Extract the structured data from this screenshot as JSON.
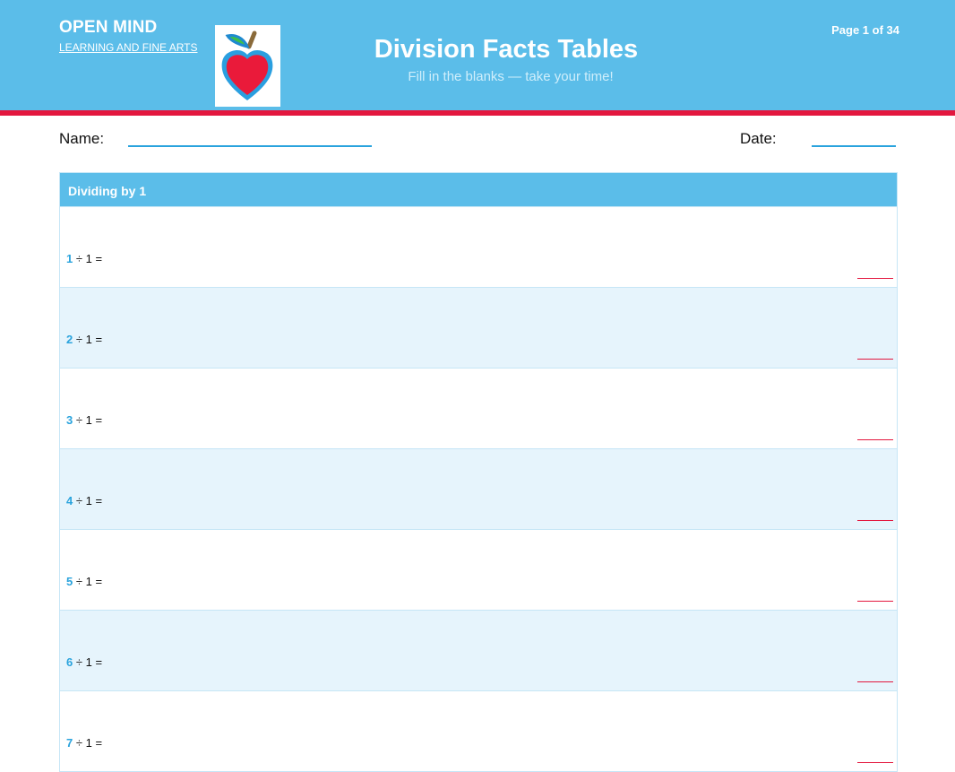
{
  "header": {
    "brand": "OPEN MIND",
    "brand_sub": "LEARNING AND FINE ARTS",
    "title": "Division Facts Tables",
    "subtitle": "Fill in the blanks — take your time!",
    "page": "Page 1 of 34",
    "logo_icon": "apple-icon"
  },
  "form": {
    "name_label": "Name:",
    "date_label": "Date:"
  },
  "table": {
    "heading": "Dividing by 1",
    "rows": [
      {
        "dividend": "1",
        "rest": "÷ 1 ="
      },
      {
        "dividend": "2",
        "rest": "÷ 1 ="
      },
      {
        "dividend": "3",
        "rest": "÷ 1 ="
      },
      {
        "dividend": "4",
        "rest": "÷ 1 ="
      },
      {
        "dividend": "5",
        "rest": "÷ 1 ="
      },
      {
        "dividend": "6",
        "rest": "÷ 1 ="
      },
      {
        "dividend": "7",
        "rest": "÷ 1 ="
      }
    ]
  },
  "colors": {
    "header_blue": "#5bbde9",
    "accent_red": "#e3173e",
    "row_alt": "#e6f4fc",
    "number_blue": "#2aa3dd"
  }
}
